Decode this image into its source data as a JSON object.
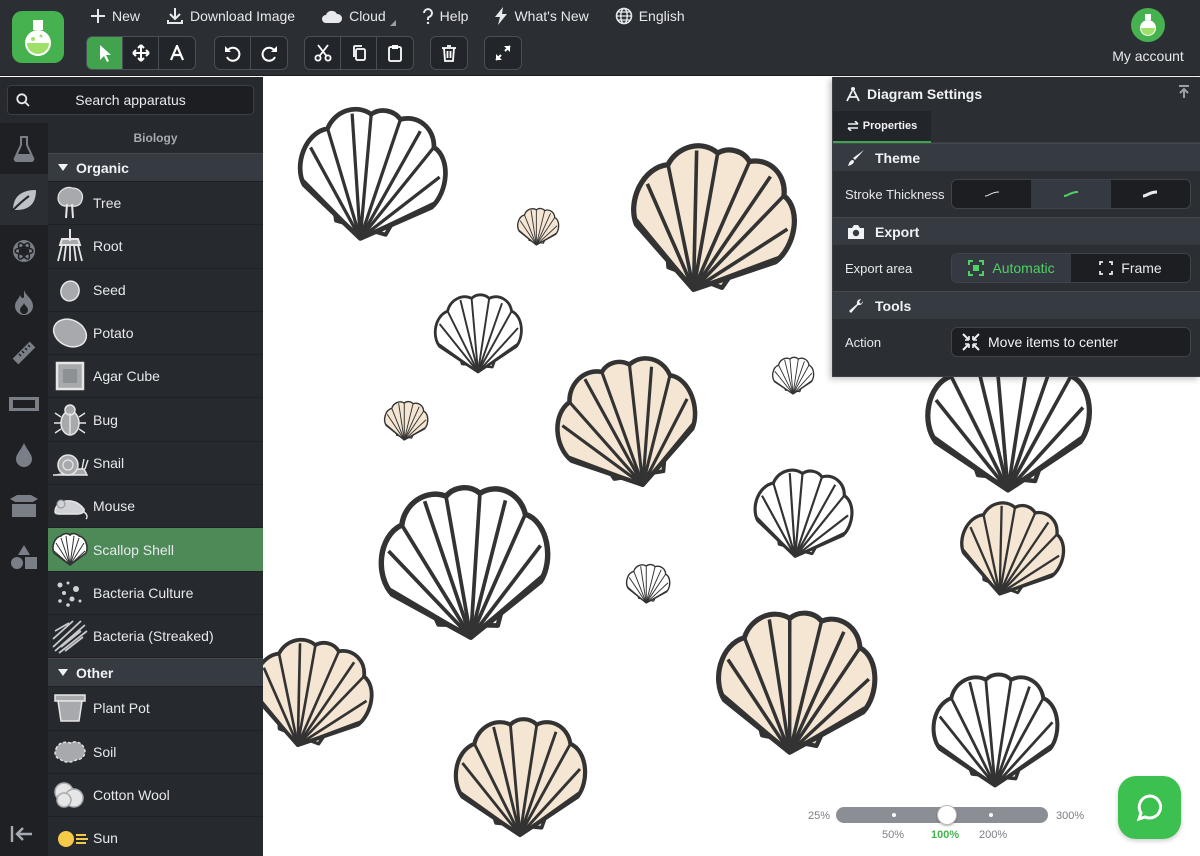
{
  "menu": {
    "new": "New",
    "download": "Download Image",
    "cloud": "Cloud",
    "help": "Help",
    "whats_new": "What's New",
    "language": "English"
  },
  "account": {
    "label": "My account"
  },
  "search": {
    "placeholder": "Search apparatus"
  },
  "library": {
    "category": "Biology",
    "sections": [
      {
        "title": "Organic",
        "items": [
          "Tree",
          "Root",
          "Seed",
          "Potato",
          "Agar Cube",
          "Bug",
          "Snail",
          "Mouse",
          "Scallop Shell",
          "Bacteria Culture",
          "Bacteria (Streaked)"
        ]
      },
      {
        "title": "Other",
        "items": [
          "Plant Pot",
          "Soil",
          "Cotton Wool",
          "Sun"
        ]
      }
    ],
    "selected": "Scallop Shell"
  },
  "settings": {
    "title": "Diagram Settings",
    "tab": "Properties",
    "theme": {
      "title": "Theme",
      "stroke_label": "Stroke Thickness"
    },
    "export": {
      "title": "Export",
      "area_label": "Export area",
      "automatic": "Automatic",
      "frame": "Frame"
    },
    "tools": {
      "title": "Tools",
      "action_label": "Action",
      "move_center": "Move items to center"
    }
  },
  "zoom": {
    "min": "25%",
    "max": "300%",
    "marks": [
      "50%",
      "100%",
      "200%"
    ],
    "current": "100%"
  },
  "colors": {
    "accent": "#45b24f",
    "shell_fill": "#f5e6d3",
    "shell_white": "#ffffff",
    "stroke": "#333333"
  }
}
